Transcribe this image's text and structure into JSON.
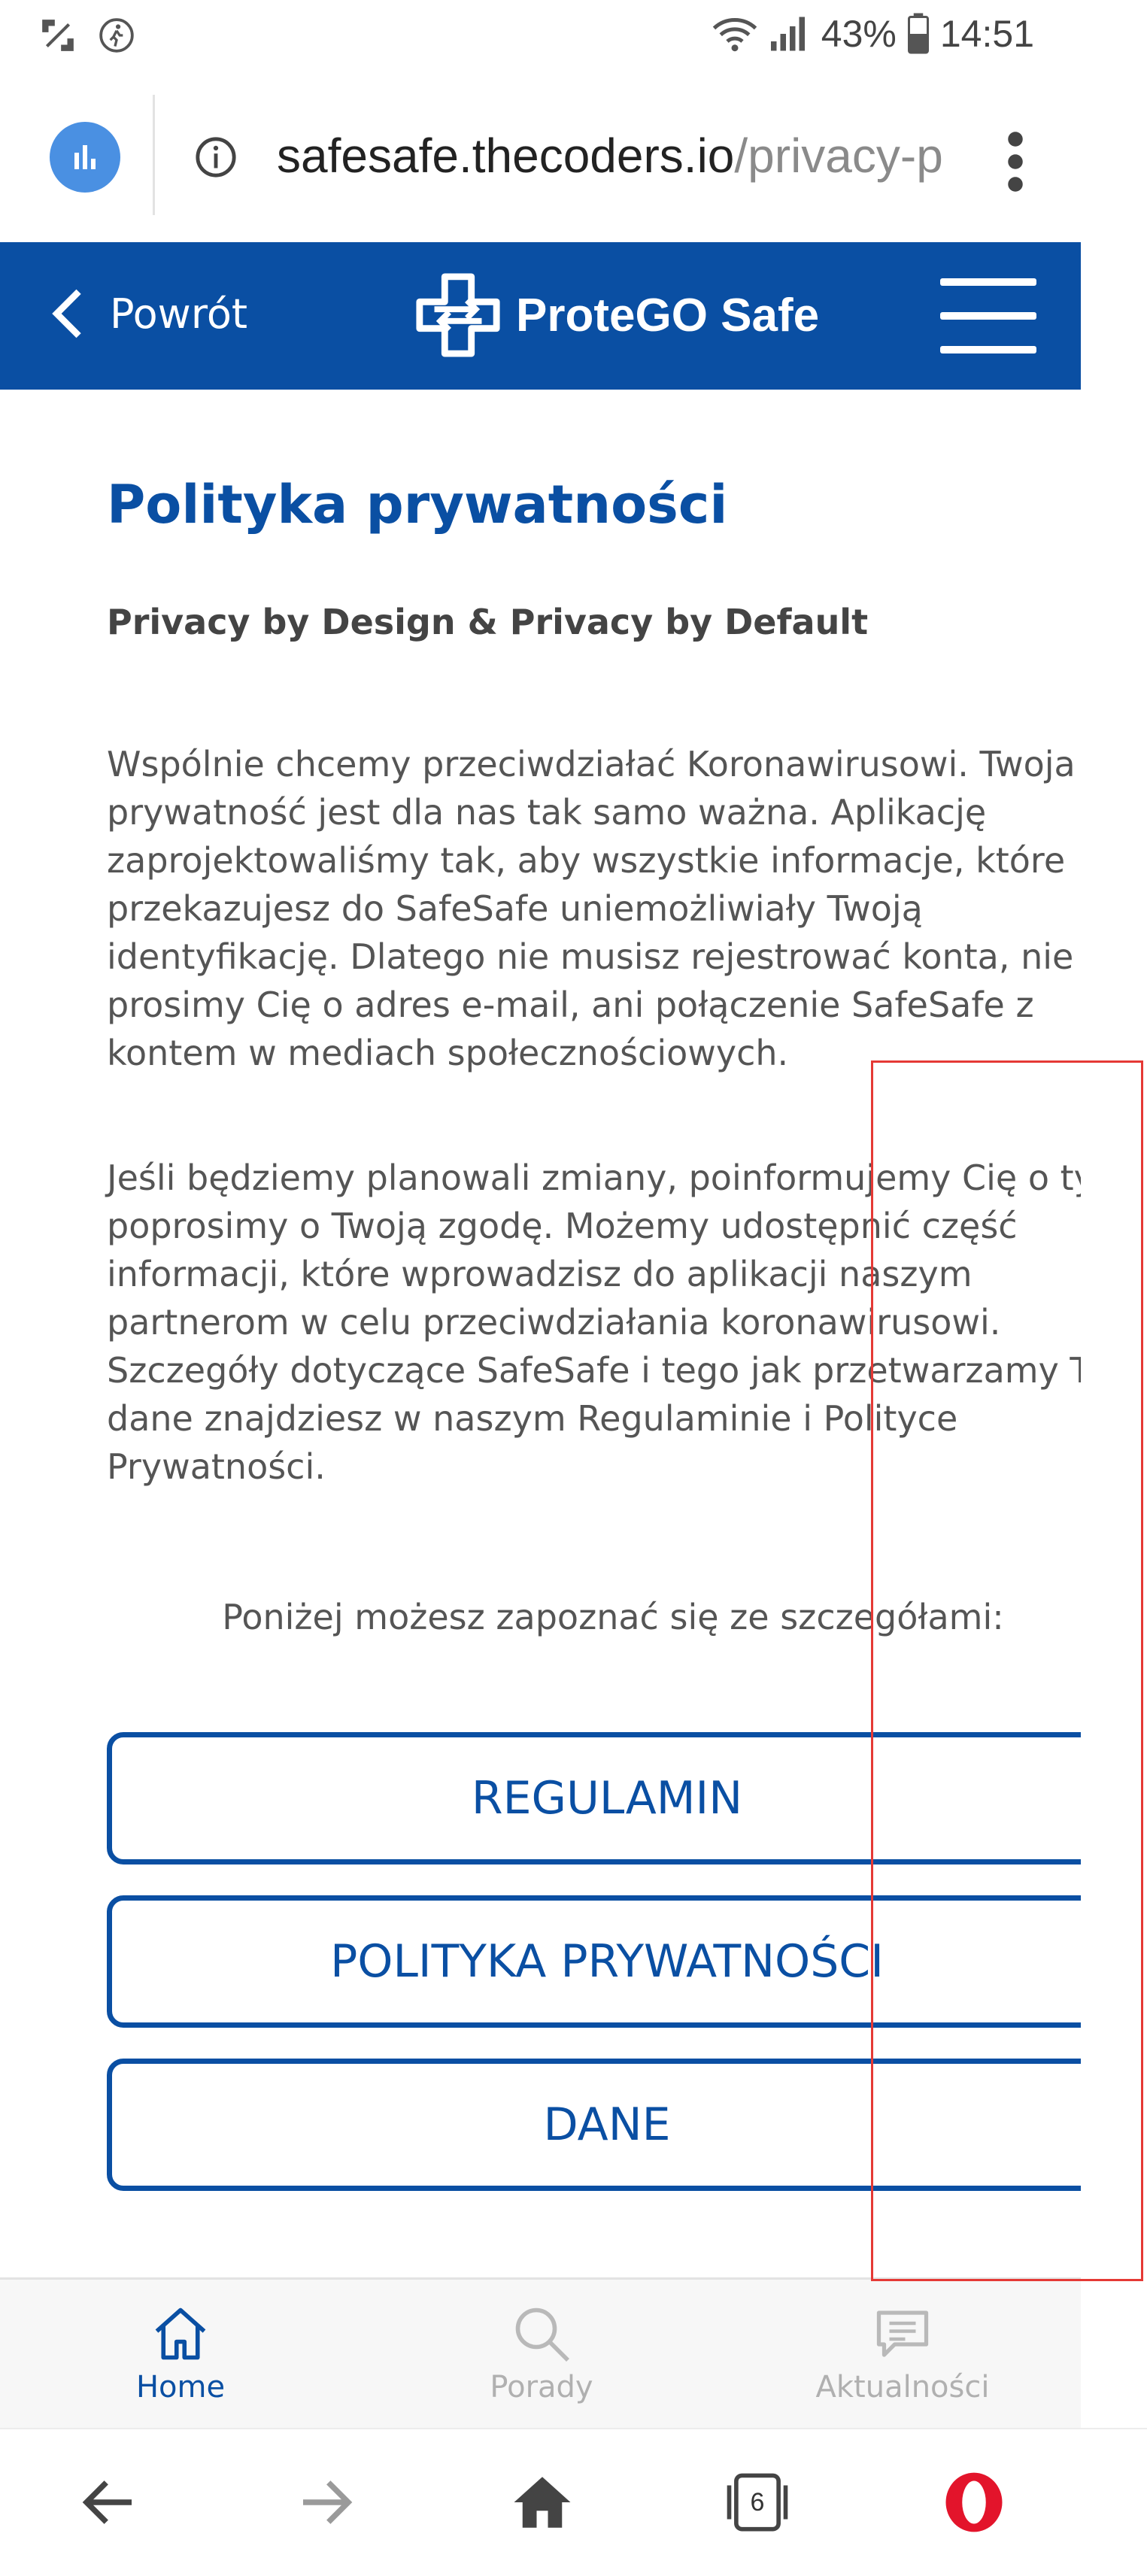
{
  "status_bar": {
    "battery_percent": "43%",
    "time": "14:51"
  },
  "browser": {
    "url_host": "safesafe.thecoders.io",
    "url_path": "/privacy-p"
  },
  "header": {
    "back_label": "Powrót",
    "logo_text": "ProteGO Safe"
  },
  "main": {
    "title": "Polityka prywatności",
    "subtitle": "Privacy by Design & Privacy by Default",
    "paragraph1_lines": [
      "Wspólnie chcemy przeciwdziałać Koronawirusowi. Twoja",
      "prywatność jest dla nas tak samo ważna. Aplikację",
      "zaprojektowaliśmy tak, aby wszystkie informacje, które",
      "przekazujesz do SafeSafe uniemożliwiały Twoją",
      "identyfikację. Dlatego nie musisz rejestrować konta, nie",
      "prosimy Cię o adres e-mail, ani połączenie SafeSafe z",
      "kontem w mediach społecznościowych."
    ],
    "paragraph2_lines": [
      "Jeśli będziemy planowali zmiany, poinformujemy Cię o tym",
      "poprosimy o Twoją zgodę. Możemy udostępnić część",
      "informacji, które wprowadzisz do aplikacji naszym",
      "partnerom w celu przeciwdziałania koronawirusowi.",
      "Szczegóły dotyczące SafeSafe i tego jak przetwarzamy Two",
      "dane znajdziesz w naszym Regulaminie i Polityce",
      "Prywatności."
    ],
    "intro": "Poniżej możesz zapoznać się ze szczegółami:",
    "buttons": [
      "REGULAMIN",
      "POLITYKA PRYWATNOŚCI",
      "DANE"
    ]
  },
  "site_nav": {
    "items": [
      {
        "label": "Home",
        "icon": "home-icon",
        "active": true
      },
      {
        "label": "Porady",
        "icon": "search-icon",
        "active": false
      },
      {
        "label": "Aktualności",
        "icon": "news-icon",
        "active": false
      }
    ]
  },
  "toolbar": {
    "tabs_count": "6"
  },
  "colors": {
    "brand_blue": "#0a4fa3",
    "badge_blue": "#4a90e2",
    "highlight_red": "#e53935",
    "opera_red": "#e3142b"
  }
}
